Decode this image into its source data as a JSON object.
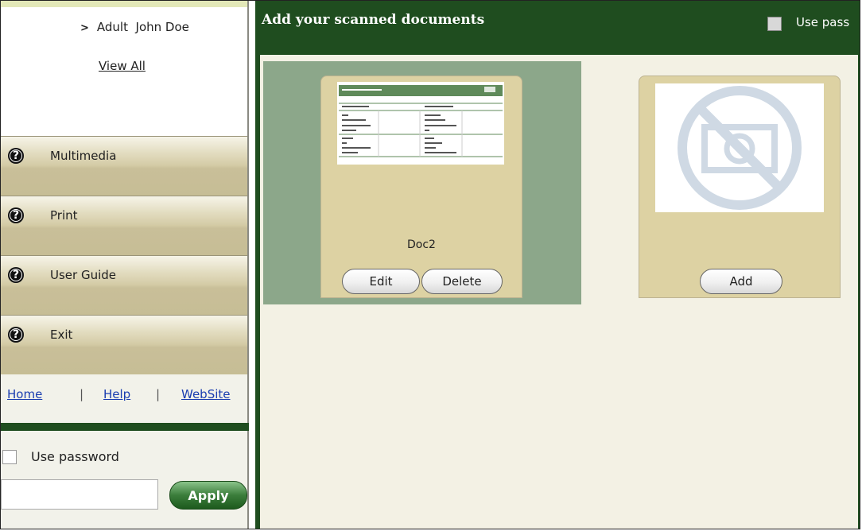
{
  "sidebar": {
    "patient": {
      "chevron": ">",
      "name": "Adult  John Doe"
    },
    "view_all": "View All",
    "menu": [
      {
        "label": "Multimedia",
        "icon": "help-icon"
      },
      {
        "label": "Print",
        "icon": "help-icon"
      },
      {
        "label": "User Guide",
        "icon": "help-icon"
      },
      {
        "label": "Exit",
        "icon": "help-icon"
      }
    ],
    "links": {
      "home": "Home",
      "help": "Help",
      "website": "WebSite",
      "separator": "|"
    },
    "password": {
      "label": "Use password",
      "checked": false,
      "value": "",
      "apply": "Apply"
    }
  },
  "main": {
    "title": "Add your scanned documents",
    "use_password_label": "Use pass",
    "documents": [
      {
        "name": "Doc2",
        "selected": true,
        "edit_label": "Edit",
        "delete_label": "Delete"
      }
    ],
    "add_label": "Add"
  },
  "colors": {
    "header_green": "#1f4d1f",
    "selected_doc_bg": "#8ca78a",
    "card_tan": "#ddd2a3",
    "content_bg": "#f3f1e4",
    "link_blue": "#1a3db0"
  }
}
